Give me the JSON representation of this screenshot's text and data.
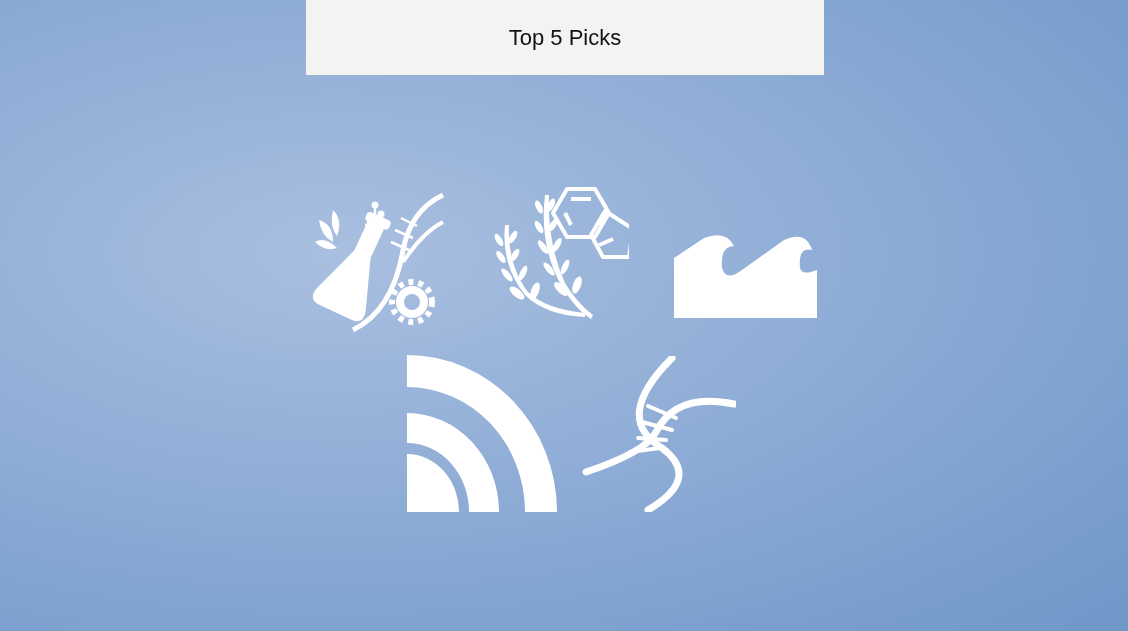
{
  "header": {
    "title": "Top 5 Picks"
  }
}
